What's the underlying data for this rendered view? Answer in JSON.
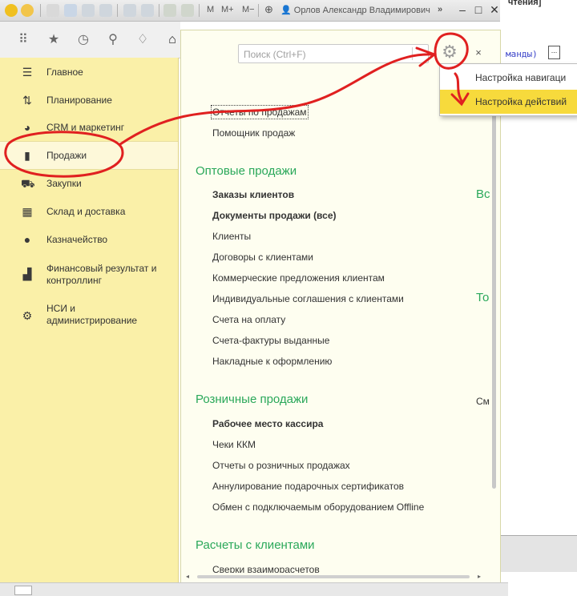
{
  "titlebar": {
    "app_icon": "1c-logo-icon",
    "toolbar_icons": [
      "dropdown-circle-icon",
      "doc-icon",
      "save-icon",
      "print-icon",
      "preview-icon",
      "copy-icon",
      "paste-icon",
      "calc-icon",
      "calendar-icon"
    ],
    "memory_buttons": [
      "M",
      "M+",
      "M−"
    ],
    "zoom_icon": "zoom-icon",
    "user": "Орлов Александр Владимирович",
    "more": "»",
    "minimize": "–",
    "maximize": "□",
    "close": "✕"
  },
  "background_window": {
    "header_fragment": "чтения]",
    "commands_fragment": "манды)",
    "ellipsis": "..."
  },
  "toolbar": {
    "icons": [
      "apps-icon",
      "star-icon",
      "history-icon",
      "search-icon",
      "bell-icon",
      "home-icon"
    ]
  },
  "sidebar": {
    "items": [
      {
        "label": "Главное",
        "icon": "menu-lines-icon"
      },
      {
        "label": "Планирование",
        "icon": "planning-icon"
      },
      {
        "label": "CRM и маркетинг",
        "icon": "pie-chart-icon"
      },
      {
        "label": "Продажи",
        "icon": "shopping-bag-icon"
      },
      {
        "label": "Закупки",
        "icon": "cart-icon"
      },
      {
        "label": "Склад и доставка",
        "icon": "warehouse-icon"
      },
      {
        "label": "Казначейство",
        "icon": "ruble-icon"
      },
      {
        "label": "Финансовый результат и\nконтроллинг",
        "icon": "bar-chart-icon"
      },
      {
        "label": "НСИ и\nадминистрирование",
        "icon": "gear-icon"
      }
    ]
  },
  "main": {
    "search_placeholder": "Поиск (Ctrl+F)",
    "settings_icon": "gears-icon",
    "close": "×",
    "top_links": [
      "Отчеты по продажам",
      "Помощник продаж"
    ],
    "groups": [
      {
        "title": "Оптовые продажи",
        "items": [
          {
            "label": "Заказы клиентов",
            "bold": true
          },
          {
            "label": "Документы продажи (все)",
            "bold": true
          },
          {
            "label": "Клиенты",
            "bold": false
          },
          {
            "label": "Договоры с клиентами",
            "bold": false
          },
          {
            "label": "Коммерческие предложения клиентам",
            "bold": false
          },
          {
            "label": "Индивидуальные соглашения с клиентами",
            "bold": false
          },
          {
            "label": "Счета на оплату",
            "bold": false
          },
          {
            "label": "Счета-фактуры выданные",
            "bold": false
          },
          {
            "label": "Накладные к оформлению",
            "bold": false
          }
        ]
      },
      {
        "title": "Розничные продажи",
        "items": [
          {
            "label": "Рабочее место кассира",
            "bold": true
          },
          {
            "label": "Чеки ККМ",
            "bold": false
          },
          {
            "label": "Отчеты о розничных продажах",
            "bold": false
          },
          {
            "label": "Аннулирование подарочных сертификатов",
            "bold": false
          },
          {
            "label": "Обмен с подключаемым оборудованием Offline",
            "bold": false
          }
        ]
      },
      {
        "title": "Расчеты с клиентами",
        "items": [
          {
            "label": "Сверки взаиморасчетов",
            "bold": false
          }
        ]
      }
    ],
    "right_column_fragments": [
      "Вс",
      "То",
      "См"
    ]
  },
  "menu": {
    "items": [
      {
        "label": "Настройка навигаци",
        "highlighted": false
      },
      {
        "label": "Настройка действий",
        "highlighted": true
      }
    ]
  },
  "colors": {
    "sidebar_bg": "#faf0a8",
    "group_header": "#2aa85a",
    "menu_highlight": "#f7da3c",
    "annotation": "#e02020"
  }
}
